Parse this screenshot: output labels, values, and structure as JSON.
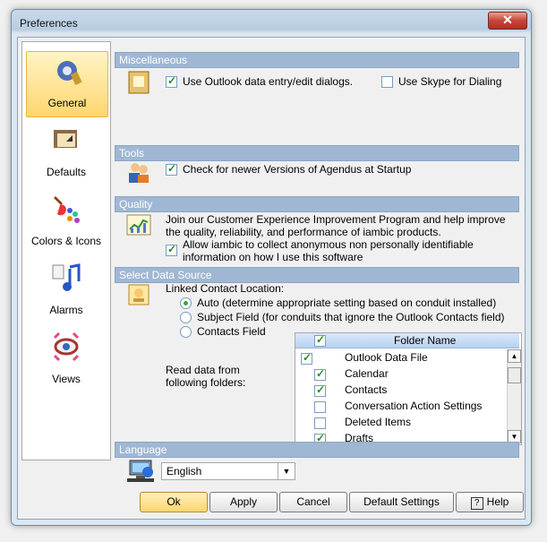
{
  "window": {
    "title": "Preferences",
    "close_label": "✕"
  },
  "sidebar": {
    "items": [
      {
        "label": "General",
        "icon": "gear-icon"
      },
      {
        "label": "Defaults",
        "icon": "folder-icon"
      },
      {
        "label": "Colors & Icons",
        "icon": "palette-icon"
      },
      {
        "label": "Alarms",
        "icon": "music-note-icon"
      },
      {
        "label": "Views",
        "icon": "eye-icon"
      }
    ]
  },
  "sections": {
    "misc": {
      "header": "Miscellaneous",
      "opt1": "Use Outlook data entry/edit dialogs.",
      "opt2": "Use Skype for Dialing"
    },
    "tools": {
      "header": "Tools",
      "opt1": "Check for newer Versions of Agendus at Startup"
    },
    "quality": {
      "header": "Quality",
      "desc": "Join our Customer Experience Improvement Program and help improve the quality, reliability, and performance of iambic products.",
      "opt1": "Allow iambic to collect anonymous non personally identifiable information on how I use this software"
    },
    "source": {
      "header": "Select Data Source",
      "linked_label": "Linked Contact Location:",
      "radios": [
        "Auto (determine appropriate setting based on conduit installed)",
        "Subject Field (for conduits that ignore the Outlook Contacts field)",
        "Contacts Field"
      ],
      "read_label": "Read data from following folders:",
      "grid_header": "Folder Name",
      "folders": [
        "Outlook Data File",
        "Calendar",
        "Contacts",
        "Conversation Action Settings",
        "Deleted Items",
        "Drafts"
      ]
    },
    "language": {
      "header": "Language",
      "value": "English"
    }
  },
  "buttons": {
    "ok": "Ok",
    "apply": "Apply",
    "cancel": "Cancel",
    "default": "Default Settings",
    "help": "Help"
  }
}
